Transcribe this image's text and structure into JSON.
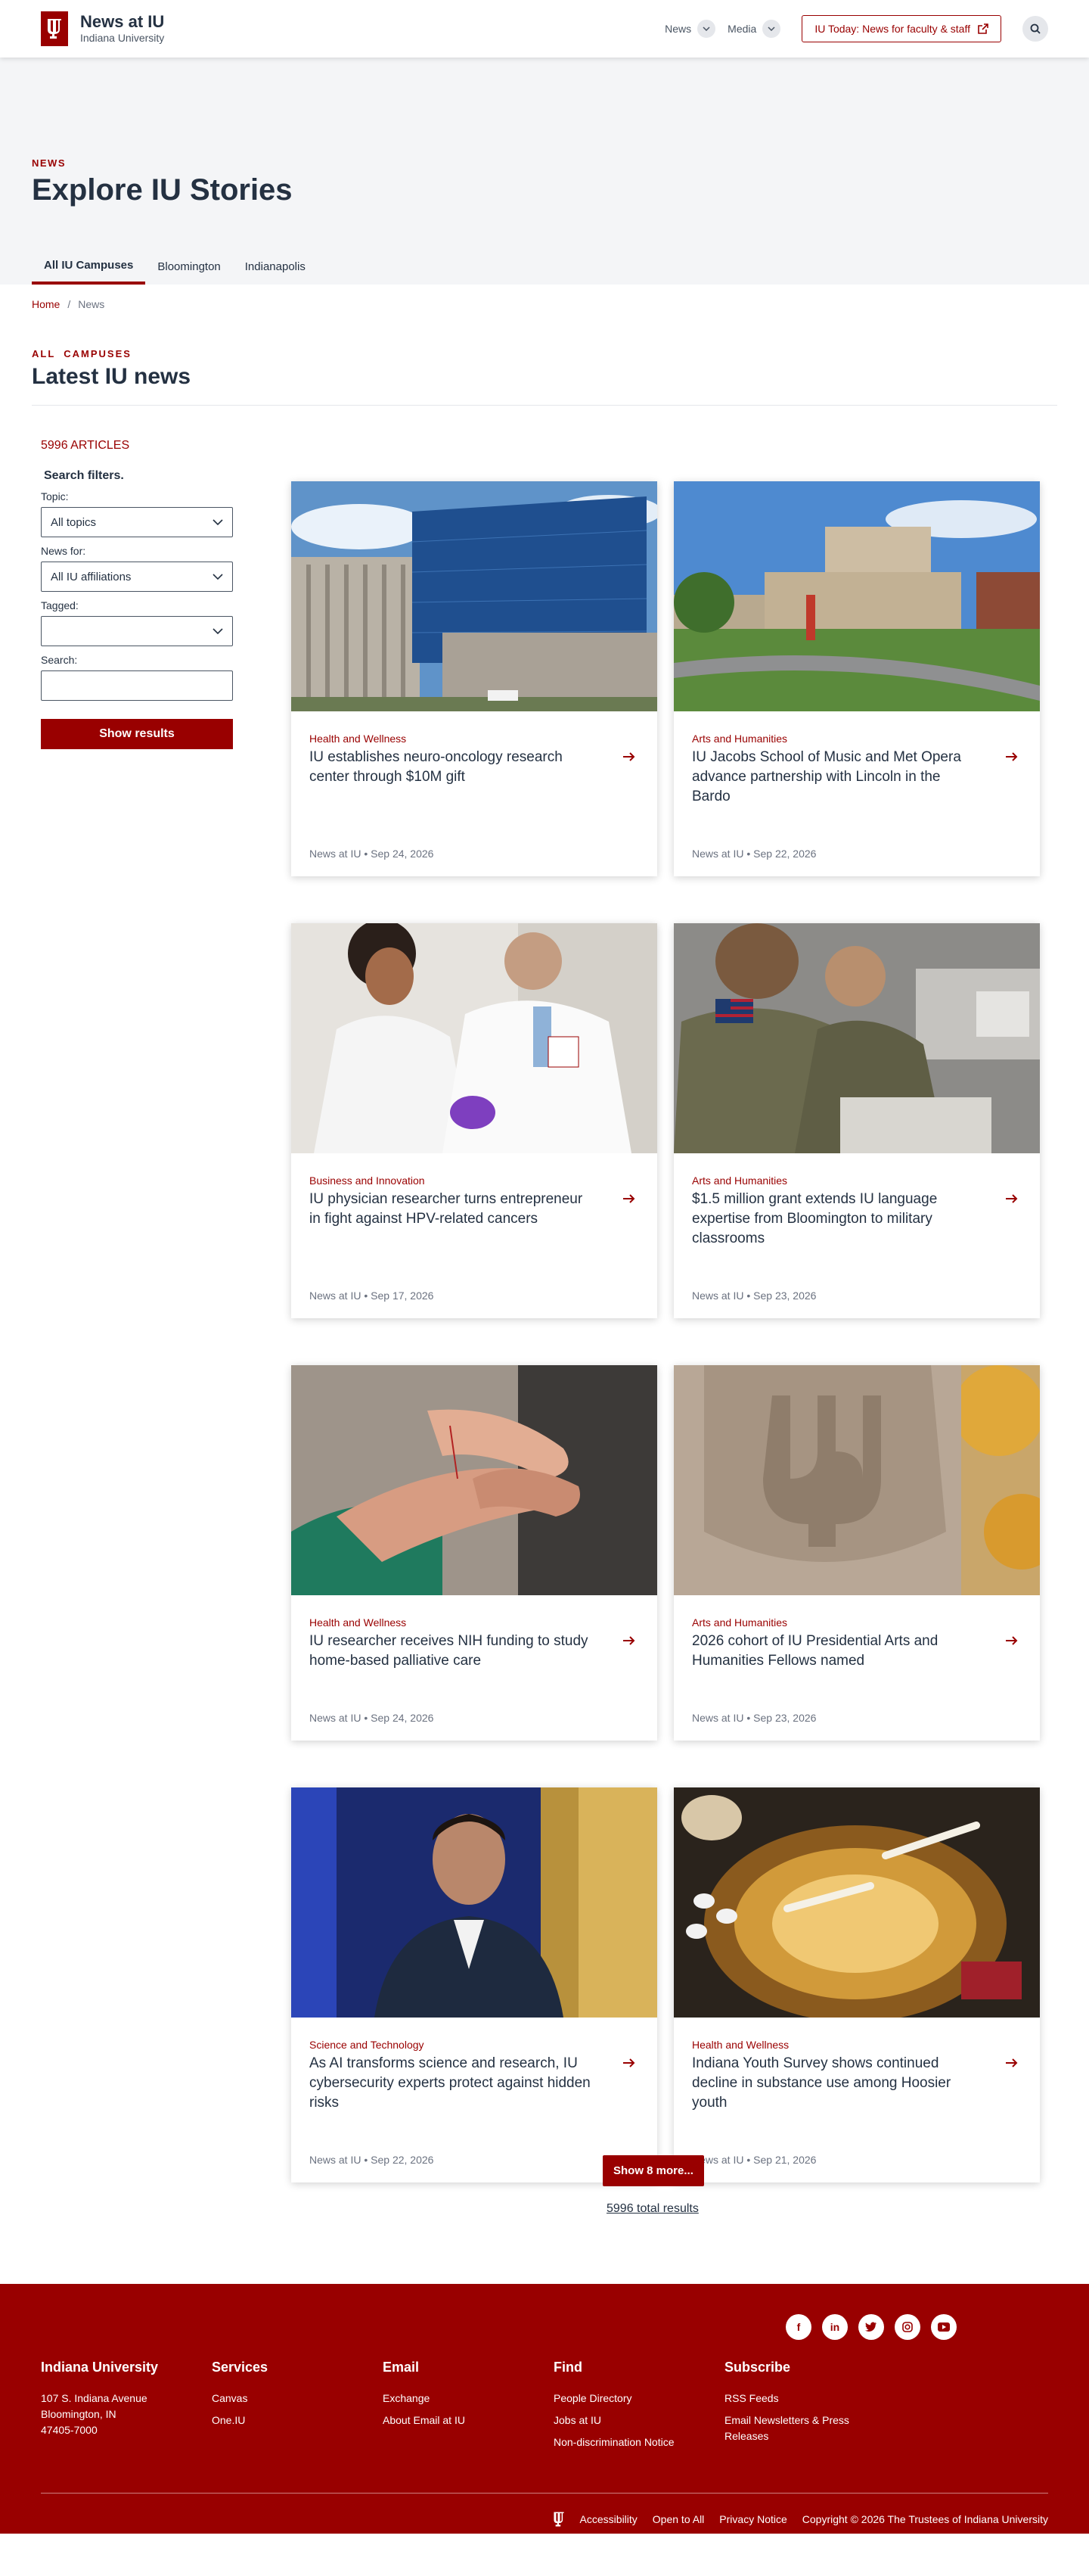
{
  "header": {
    "title": "News at IU",
    "subtitle": "Indiana University",
    "nav": [
      {
        "label": "News"
      },
      {
        "label": "Media"
      }
    ],
    "today_label": "IU Today: News for faculty & staff"
  },
  "hero": {
    "eyebrow": "NEWS",
    "title": "Explore IU Stories",
    "tabs": [
      "All IU Campuses",
      "Bloomington",
      "Indianapolis"
    ]
  },
  "breadcrumb": {
    "home": "Home",
    "sep": "/",
    "current": "News"
  },
  "section": {
    "eyebrow": "ALL  CAMPUSES",
    "title": "Latest IU news"
  },
  "sidebar": {
    "count": "5996 ARTICLES",
    "filters_title": "Search filters.",
    "topic_label": "Topic:",
    "topic_value": "All topics",
    "news_for_label": "News for:",
    "news_for_value": "All IU affiliations",
    "tagged_label": "Tagged:",
    "tagged_value": "",
    "search_label": "Search:",
    "search_placeholder": "",
    "show_results": "Show results"
  },
  "cards": [
    {
      "category": "Health and Wellness",
      "title": "IU establishes neuro-oncology research center through $10M gift",
      "meta": "News at IU • Sep 24, 2026",
      "image": "glass-office-building"
    },
    {
      "category": "Arts and Humanities",
      "title": "IU Jacobs School of Music and Met Opera advance partnership with Lincoln in the Bardo",
      "meta": "News at IU • Sep 22, 2026",
      "image": "music-building-campus"
    },
    {
      "category": "Business and Innovation",
      "title": "IU physician researcher turns entrepreneur in fight against HPV-related cancers",
      "meta": "News at IU • Sep 17, 2026",
      "image": "researchers-lab-coats"
    },
    {
      "category": "Arts and Humanities",
      "title": "$1.5 million grant extends IU language expertise from Bloomington to military classrooms",
      "meta": "News at IU • Sep 23, 2026",
      "image": "soldiers-classroom"
    },
    {
      "category": "Health and Wellness",
      "title": "IU researcher receives NIH funding to study home-based palliative care",
      "meta": "News at IU • Sep 24, 2026",
      "image": "holding-hands"
    },
    {
      "category": "Arts and Humanities",
      "title": "2026 cohort of IU Presidential Arts and Humanities Fellows named",
      "meta": "News at IU • Sep 23, 2026",
      "image": "iu-stone-trident"
    },
    {
      "category": "Science and Technology",
      "title": "As AI transforms science and research, IU cybersecurity experts protect against hidden risks",
      "meta": "News at IU • Sep 22, 2026",
      "image": "portrait-server-room"
    },
    {
      "category": "Health and Wellness",
      "title": "Indiana Youth Survey shows continued decline in substance use among Hoosier youth",
      "meta": "News at IU • Sep 21, 2026",
      "image": "ashtray-pills"
    }
  ],
  "more_label": "Show 8 more...",
  "total_label": "5996 total results",
  "footer": {
    "social": [
      "facebook-icon",
      "linkedin-icon",
      "twitter-icon",
      "instagram-icon",
      "youtube-icon"
    ],
    "columns": [
      {
        "heading": "Indiana University",
        "links": [
          "107 S. Indiana Avenue",
          "Bloomington, IN",
          "47405-7000"
        ]
      },
      {
        "heading": "Services",
        "links": [
          "Canvas",
          "One.IU"
        ]
      },
      {
        "heading": "Email",
        "links": [
          "Exchange",
          "About Email at IU"
        ]
      },
      {
        "heading": "Find",
        "links": [
          "People Directory",
          "Jobs at IU",
          "Non-discrimination Notice"
        ]
      },
      {
        "heading": "Subscribe",
        "links": [
          "RSS Feeds",
          "Email Newsletters & Press Releases"
        ]
      }
    ],
    "legal": [
      "Accessibility",
      "Open to All",
      "Privacy Notice",
      "Copyright © 2026 The Trustees of Indiana University"
    ]
  },
  "colors": {
    "brand": "#990000",
    "text": "#243142",
    "hero_bg": "#f4f5f7"
  }
}
